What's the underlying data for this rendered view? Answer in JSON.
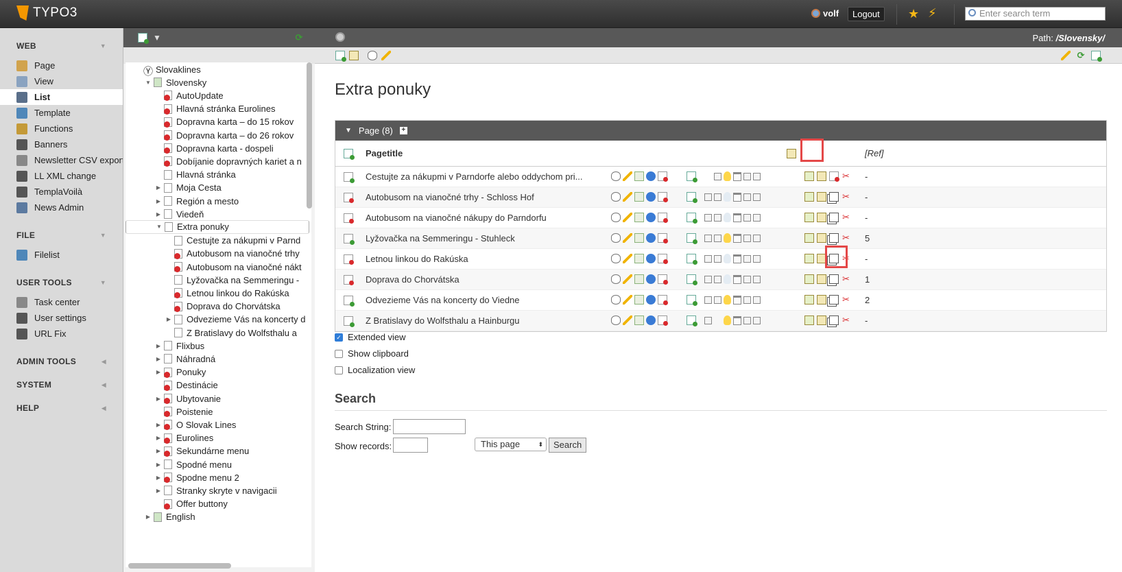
{
  "topbar": {
    "brand": "TYPO3",
    "username": "volf",
    "logout": "Logout",
    "search_placeholder": "Enter search term"
  },
  "modules": [
    {
      "section": "WEB",
      "items": [
        {
          "label": "Page"
        },
        {
          "label": "View"
        },
        {
          "label": "List",
          "active": true
        },
        {
          "label": "Template"
        },
        {
          "label": "Functions"
        },
        {
          "label": "Banners"
        },
        {
          "label": "Newsletter CSV export"
        },
        {
          "label": "LL XML change"
        },
        {
          "label": "TemplaVoilà"
        },
        {
          "label": "News Admin"
        }
      ]
    },
    {
      "section": "FILE",
      "items": [
        {
          "label": "Filelist"
        }
      ]
    },
    {
      "section": "USER TOOLS",
      "items": [
        {
          "label": "Task center"
        },
        {
          "label": "User settings"
        },
        {
          "label": "URL Fix"
        }
      ]
    },
    {
      "section": "ADMIN TOOLS",
      "items": []
    },
    {
      "section": "SYSTEM",
      "items": []
    },
    {
      "section": "HELP",
      "items": []
    }
  ],
  "tree": [
    {
      "label": "Slovaklines",
      "level": 0,
      "type": "root"
    },
    {
      "label": "Slovensky",
      "level": 1,
      "type": "folder",
      "open": true
    },
    {
      "label": "AutoUpdate",
      "level": 2,
      "type": "hid"
    },
    {
      "label": "Hlavná stránka Eurolines",
      "level": 2,
      "type": "hid"
    },
    {
      "label": "Dopravna karta – do 15 rokov",
      "level": 2,
      "type": "hid"
    },
    {
      "label": "Dopravna karta – do 26 rokov",
      "level": 2,
      "type": "hid"
    },
    {
      "label": "Dopravna karta - dospeli",
      "level": 2,
      "type": "hid"
    },
    {
      "label": "Dobíjanie dopravných kariet a n",
      "level": 2,
      "type": "hid"
    },
    {
      "label": "Hlavná stránka",
      "level": 2,
      "type": "page"
    },
    {
      "label": "Moja Cesta",
      "level": 2,
      "type": "page",
      "exp": true
    },
    {
      "label": "Región a mesto",
      "level": 2,
      "type": "page",
      "exp": true
    },
    {
      "label": "Viedeň",
      "level": 2,
      "type": "page",
      "exp": true
    },
    {
      "label": "Extra ponuky",
      "level": 2,
      "type": "page",
      "open": true,
      "sel": true
    },
    {
      "label": "Cestujte za nákupmi v Parnd",
      "level": 3,
      "type": "page"
    },
    {
      "label": "Autobusom na vianočné trhy",
      "level": 3,
      "type": "hid"
    },
    {
      "label": "Autobusom na vianočné nákt",
      "level": 3,
      "type": "hid"
    },
    {
      "label": "Lyžovačka na Semmeringu -",
      "level": 3,
      "type": "page"
    },
    {
      "label": "Letnou linkou do Rakúska",
      "level": 3,
      "type": "hid"
    },
    {
      "label": "Doprava do Chorvátska",
      "level": 3,
      "type": "hid"
    },
    {
      "label": "Odvezieme Vás na koncerty d",
      "level": 3,
      "type": "page",
      "exp": true
    },
    {
      "label": "Z Bratislavy do Wolfsthalu a",
      "level": 3,
      "type": "page"
    },
    {
      "label": "Flixbus",
      "level": 2,
      "type": "page",
      "exp": true
    },
    {
      "label": "Náhradná",
      "level": 2,
      "type": "page",
      "exp": true
    },
    {
      "label": "Ponuky",
      "level": 2,
      "type": "hid",
      "exp": true
    },
    {
      "label": "Destinácie",
      "level": 2,
      "type": "hid"
    },
    {
      "label": "Ubytovanie",
      "level": 2,
      "type": "hid",
      "exp": true
    },
    {
      "label": "Poistenie",
      "level": 2,
      "type": "hid"
    },
    {
      "label": "O Slovak Lines",
      "level": 2,
      "type": "hid",
      "exp": true
    },
    {
      "label": "Eurolines",
      "level": 2,
      "type": "hid",
      "exp": true
    },
    {
      "label": "Sekundárne menu",
      "level": 2,
      "type": "hid",
      "exp": true
    },
    {
      "label": "Spodné menu",
      "level": 2,
      "type": "page",
      "exp": true
    },
    {
      "label": "Spodne menu 2",
      "level": 2,
      "type": "hid",
      "exp": true
    },
    {
      "label": "Stranky skryte v navigacii",
      "level": 2,
      "type": "page",
      "exp": true
    },
    {
      "label": "Offer buttony",
      "level": 2,
      "type": "hid"
    },
    {
      "label": "English",
      "level": 1,
      "type": "folder",
      "exp": true
    }
  ],
  "docheader": {
    "path_label": "Path:",
    "path_value": "/Slovensky/"
  },
  "content": {
    "title": "Extra ponuky",
    "table_header": "Page (8)",
    "col_title": "Pagetitle",
    "col_ref": "[Ref]",
    "rows": [
      {
        "title": "Cestujte za nákupmi v Parndorfe alebo oddychom pri...",
        "hidden": false,
        "bulb": true,
        "ref": "-",
        "up": false,
        "down": true,
        "del_hidden": true
      },
      {
        "title": "Autobusom na vianočné trhy - Schloss Hof",
        "hidden": true,
        "bulb": false,
        "ref": "-",
        "up": true,
        "down": true
      },
      {
        "title": "Autobusom na vianočné nákupy do Parndorfu",
        "hidden": true,
        "bulb": false,
        "ref": "-",
        "up": true,
        "down": true
      },
      {
        "title": "Lyžovačka na Semmeringu - Stuhleck",
        "hidden": false,
        "bulb": true,
        "ref": "5",
        "up": true,
        "down": true
      },
      {
        "title": "Letnou linkou do Rakúska",
        "hidden": true,
        "bulb": false,
        "ref": "-",
        "up": true,
        "down": true
      },
      {
        "title": "Doprava do Chorvátska",
        "hidden": true,
        "bulb": false,
        "ref": "1",
        "up": true,
        "down": true
      },
      {
        "title": "Odvezieme Vás na koncerty do Viedne",
        "hidden": false,
        "bulb": true,
        "ref": "2",
        "up": true,
        "down": true
      },
      {
        "title": "Z Bratislavy do Wolfsthalu a Hainburgu",
        "hidden": false,
        "bulb": true,
        "ref": "-",
        "up": true,
        "down": false
      }
    ],
    "options": [
      {
        "label": "Extended view",
        "checked": true
      },
      {
        "label": "Show clipboard",
        "checked": false
      },
      {
        "label": "Localization view",
        "checked": false
      }
    ],
    "search_heading": "Search",
    "search_string_label": "Search String:",
    "search_scope": "This page",
    "search_button": "Search",
    "show_records_label": "Show records:"
  },
  "colors": {
    "accent": "#f49700",
    "header": "#585858",
    "highlight": "#e44848"
  }
}
